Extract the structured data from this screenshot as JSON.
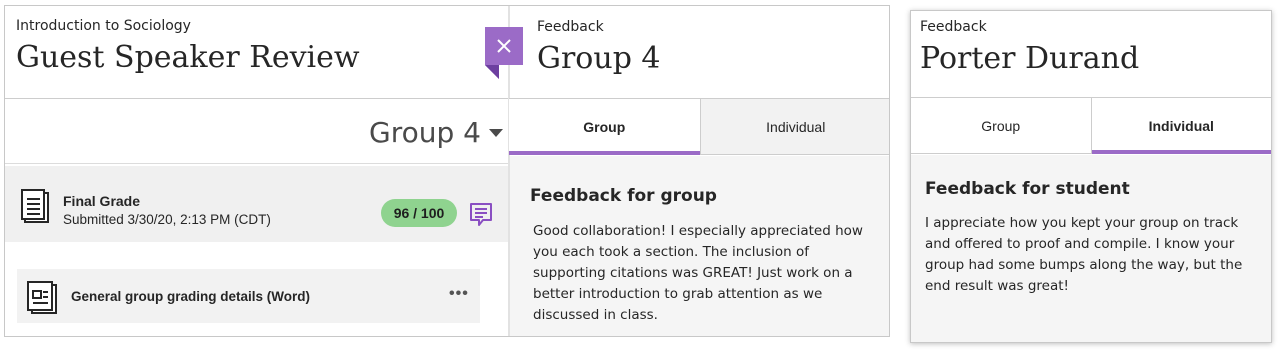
{
  "left": {
    "course": "Introduction to Sociology",
    "assignment_title": "Guest Speaker Review",
    "group_select": "Group 4",
    "grade_row": {
      "label": "Final Grade",
      "submitted": "Submitted 3/30/20, 2:13 PM (CDT)",
      "grade": "96 / 100"
    },
    "attachment": {
      "label": "General group grading details (Word)",
      "menu": "•••"
    },
    "close_icon": "×"
  },
  "group_feedback": {
    "label": "Feedback",
    "title": "Group 4",
    "tabs": [
      "Group",
      "Individual"
    ],
    "active_tab": "Group",
    "heading": "Feedback for group",
    "text": "Good collaboration! I especially appreciated how you each took a section. The inclusion of supporting citations was GREAT! Just work on a better introduction to grab attention as we discussed in class."
  },
  "student_feedback": {
    "label": "Feedback",
    "title": "Porter Durand",
    "tabs": [
      "Group",
      "Individual"
    ],
    "active_tab": "Individual",
    "heading": "Feedback for student",
    "text": "I appreciate how you kept your group on track and offered to proof and compile. I know your group had some bumps along the way, but the end result was great!"
  },
  "colors": {
    "accent": "#9b6bc7",
    "grade_pill": "#8fd38f",
    "row_bg": "#f0f0f0"
  },
  "icons": [
    "document-icon",
    "feedback-bubble-icon",
    "word-file-icon",
    "more-options-icon",
    "close-icon"
  ]
}
